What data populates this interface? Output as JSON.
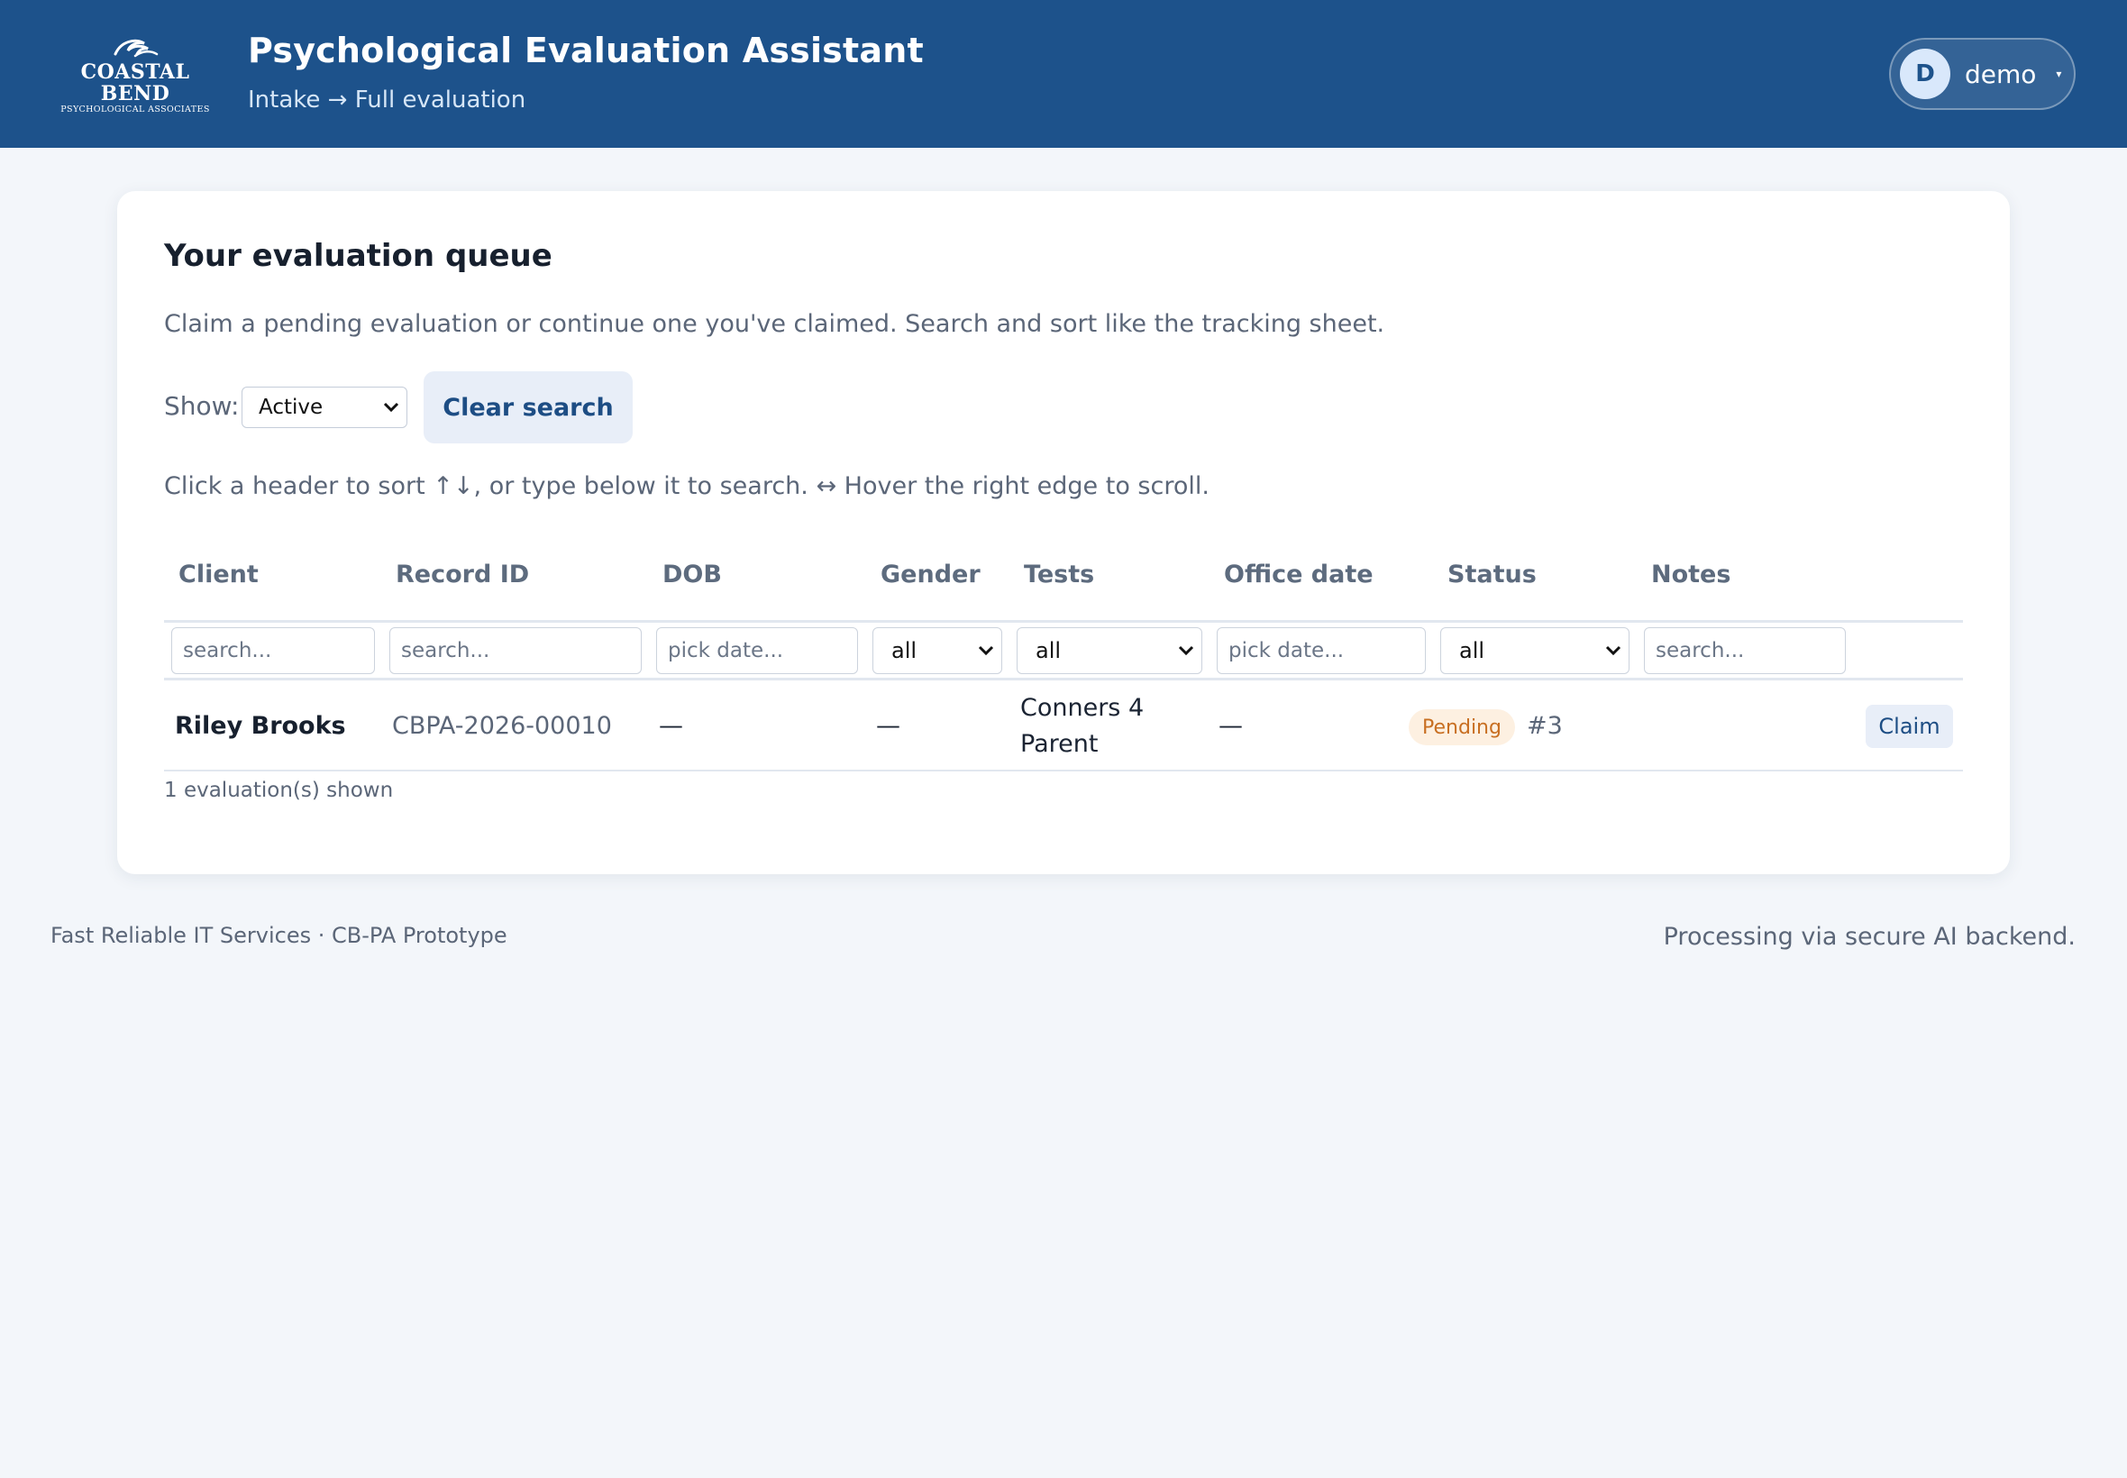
{
  "header": {
    "logo_line1": "COASTAL BEND",
    "logo_line2": "PSYCHOLOGICAL ASSOCIATES",
    "title": "Psychological Evaluation Assistant",
    "subtitle": "Intake → Full evaluation",
    "user": {
      "initial": "D",
      "name": "demo",
      "caret": "▾",
      "icon": "chevron-down-icon"
    },
    "brand_color": "#1d528b"
  },
  "queue": {
    "title": "Your evaluation queue",
    "description": "Claim a pending evaluation or continue one you've claimed. Search and sort like the tracking sheet.",
    "show_label": "Show:",
    "show_value": "Active",
    "clear_label": "Clear search",
    "hint": "Click a header to sort ↑↓, or type below it to search. ↔ Hover the right edge to scroll.",
    "columns": [
      "Client",
      "Record ID",
      "DOB",
      "Gender",
      "Tests",
      "Office date",
      "Status",
      "Notes"
    ],
    "filters": {
      "client": "search...",
      "record_id": "search...",
      "dob": "pick date...",
      "gender": "all",
      "tests": "all",
      "office_date": "pick date...",
      "status": "all",
      "notes": "search..."
    },
    "rows": [
      {
        "client": "Riley Brooks",
        "record_id": "CBPA-2026-00010",
        "dob": "—",
        "gender": "—",
        "tests_line1": "Conners 4",
        "tests_line2": "Parent",
        "office_date": "—",
        "status": "Pending",
        "status_number": "#3",
        "action": "Claim"
      }
    ],
    "count_text": "1 evaluation(s) shown",
    "status_colors": {
      "pending_bg": "#fdf0e1",
      "pending_text": "#c86f22"
    }
  },
  "footer": {
    "left": "Fast Reliable IT Services · CB-PA Prototype",
    "right": "Processing via secure AI backend."
  }
}
